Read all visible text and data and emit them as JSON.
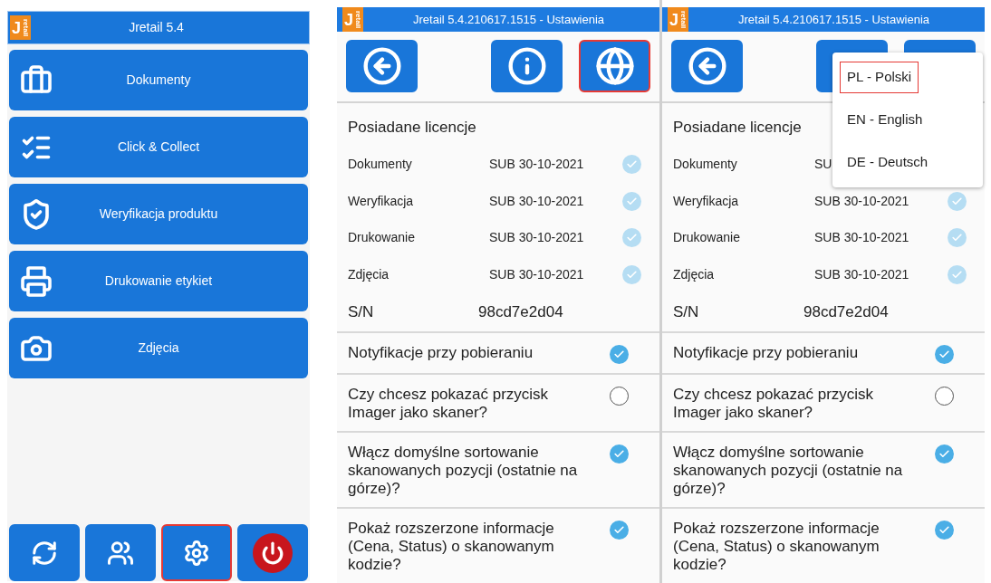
{
  "home": {
    "logo": {
      "letter": "J",
      "word": "retail"
    },
    "title": "Jretail 5.4",
    "menu": [
      {
        "kind": "briefcase",
        "label": "Dokumenty"
      },
      {
        "kind": "checklist",
        "label": "Click & Collect"
      },
      {
        "kind": "shield",
        "label": "Weryfikacja produktu"
      },
      {
        "kind": "printer",
        "label": "Drukowanie etykiet"
      },
      {
        "kind": "camera",
        "label": "Zdjęcia"
      }
    ],
    "bottom_buttons": [
      {
        "kind": "sync",
        "highlighted": false
      },
      {
        "kind": "users",
        "highlighted": false
      },
      {
        "kind": "settings",
        "highlighted": true
      },
      {
        "kind": "power",
        "highlighted": false
      }
    ]
  },
  "settings_screens": [
    {
      "logo": {
        "letter": "J",
        "word": "retail"
      },
      "title": "Jretail 5.4.210617.1515 - Ustawienia",
      "toolbar": [
        {
          "kind": "back",
          "highlighted": false,
          "covered": false
        },
        {
          "kind": "info",
          "highlighted": false,
          "covered": false
        },
        {
          "kind": "globe",
          "highlighted": true,
          "covered": false
        }
      ],
      "licenses_heading": "Posiadane licencje",
      "licenses": [
        {
          "name": "Dokumenty",
          "value": "SUB 30-10-2021",
          "checked": true
        },
        {
          "name": "Weryfikacja",
          "value": "SUB 30-10-2021",
          "checked": true
        },
        {
          "name": "Drukowanie",
          "value": "SUB 30-10-2021",
          "checked": true
        },
        {
          "name": "Zdjęcia",
          "value": "SUB 30-10-2021",
          "checked": true
        }
      ],
      "serial": {
        "label": "S/N",
        "value": "98cd7e2d04"
      },
      "options": [
        {
          "label": "Notyfikacje przy pobieraniu",
          "checked": true
        },
        {
          "label": "Czy chcesz pokazać przycisk Imager jako skaner?",
          "checked": false
        },
        {
          "label": "Włącz domyślne sortowanie skanowanych pozycji (ostatnie na górze)?",
          "checked": true
        },
        {
          "label": "Pokaż rozszerzone informacje (Cena, Status) o skanowanym kodzie?",
          "checked": true
        }
      ]
    },
    {
      "logo": {
        "letter": "J",
        "word": "retail"
      },
      "title": "Jretail 5.4.210617.1515 - Ustawienia",
      "toolbar": [
        {
          "kind": "back",
          "highlighted": false,
          "covered": false
        },
        {
          "kind": "info",
          "highlighted": false,
          "covered": true
        },
        {
          "kind": "globe",
          "highlighted": false,
          "covered": true
        }
      ],
      "licenses_heading": "Posiadane licencje",
      "licenses": [
        {
          "name": "Dokumenty",
          "value": "SU"
        },
        {
          "name": "Weryfikacja",
          "value": "SUB 30-10-2021",
          "checked": true
        },
        {
          "name": "Drukowanie",
          "value": "SUB 30-10-2021",
          "checked": true
        },
        {
          "name": "Zdjęcia",
          "value": "SUB 30-10-2021",
          "checked": true
        }
      ],
      "serial": {
        "label": "S/N",
        "value": "98cd7e2d04"
      },
      "options": [
        {
          "label": "Notyfikacje przy pobieraniu",
          "checked": true
        },
        {
          "label": "Czy chcesz pokazać przycisk Imager jako skaner?",
          "checked": false
        },
        {
          "label": "Włącz domyślne sortowanie skanowanych pozycji (ostatnie na górze)?",
          "checked": true
        },
        {
          "label": "Pokaż rozszerzone informacje (Cena, Status) o skanowanym kodzie?",
          "checked": true
        }
      ],
      "language_menu": {
        "items": [
          {
            "label": "PL - Polski",
            "selected": true
          },
          {
            "label": "EN - English",
            "selected": false
          },
          {
            "label": "DE - Deutsch",
            "selected": false
          }
        ]
      }
    }
  ]
}
